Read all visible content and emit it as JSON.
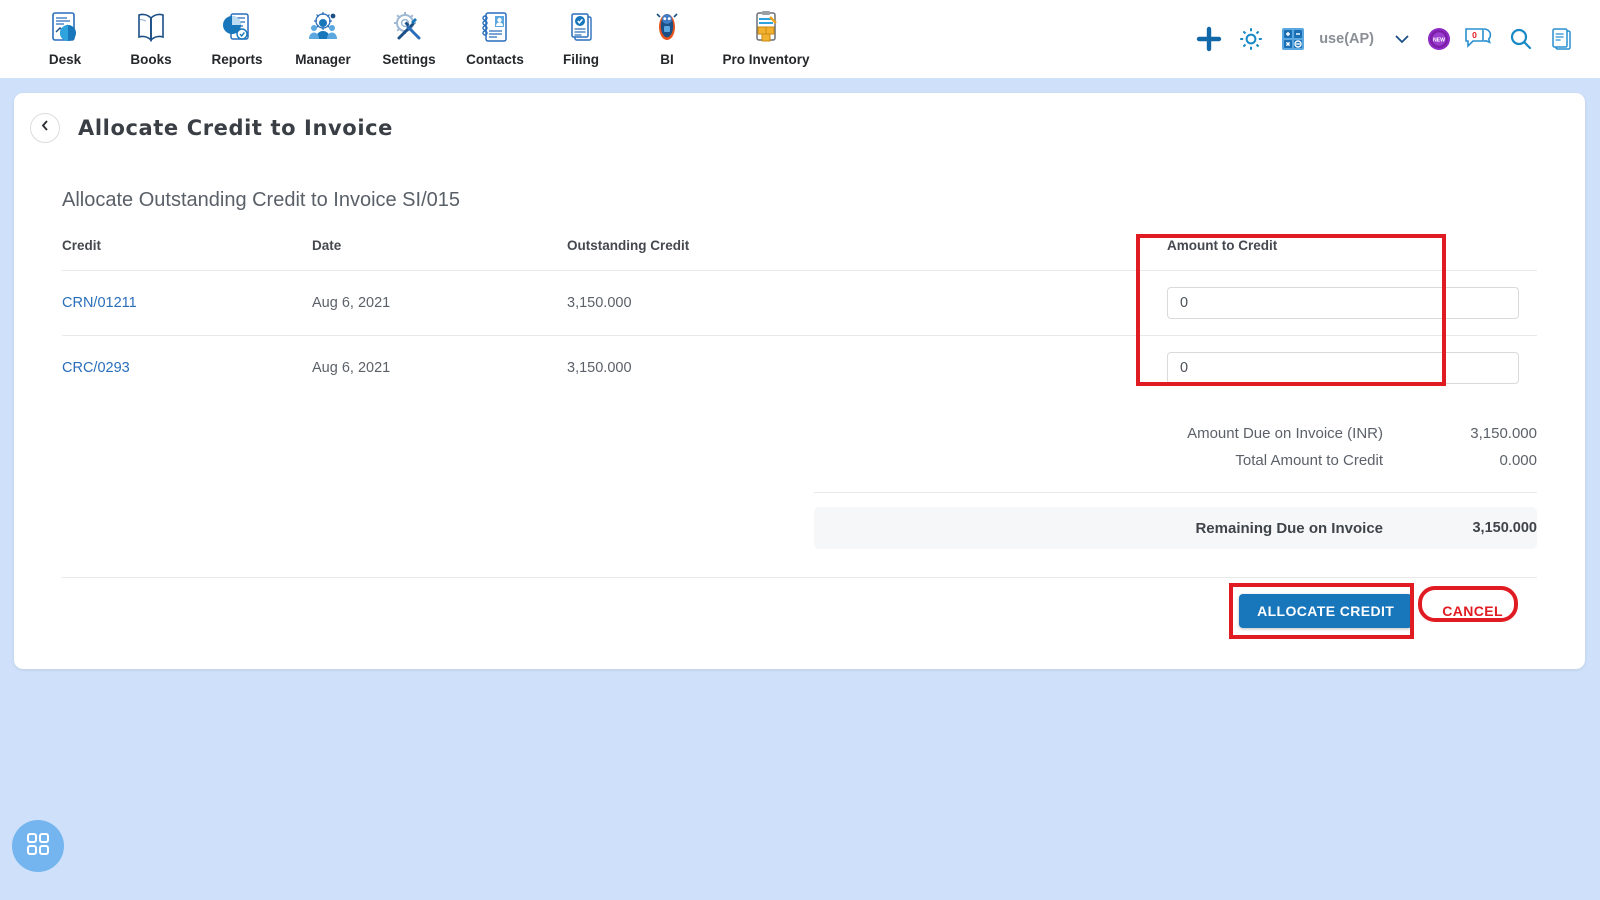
{
  "topbar": {
    "apps": [
      {
        "label": "Desk",
        "icon": "desk-icon"
      },
      {
        "label": "Books",
        "icon": "books-icon"
      },
      {
        "label": "Reports",
        "icon": "reports-icon"
      },
      {
        "label": "Manager",
        "icon": "manager-icon"
      },
      {
        "label": "Settings",
        "icon": "settings-icon"
      },
      {
        "label": "Contacts",
        "icon": "contacts-icon"
      },
      {
        "label": "Filing",
        "icon": "filing-icon"
      },
      {
        "label": "BI",
        "icon": "bi-icon"
      },
      {
        "label": "Pro Inventory",
        "icon": "pro-inventory-icon"
      }
    ],
    "org_name": "use(AP)",
    "new_badge_text": "NEW",
    "message_count": "0",
    "icons": {
      "add": "plus-icon",
      "settings": "gear-icon",
      "calculator": "calculator-icon",
      "dropdown": "chevron-down-icon",
      "new_badge": "new-badge-icon",
      "messages": "chat-bubble-icon",
      "search": "search-icon",
      "notes": "document-icon"
    }
  },
  "page": {
    "back_icon": "chevron-left-icon",
    "title": "Allocate Credit to Invoice",
    "subtitle": "Allocate Outstanding Credit to Invoice SI/015"
  },
  "table": {
    "headers": {
      "credit": "Credit",
      "date": "Date",
      "outstanding": "Outstanding Credit",
      "amount": "Amount to Credit"
    },
    "rows": [
      {
        "credit": "CRN/01211",
        "date": "Aug 6, 2021",
        "outstanding": "3,150.000",
        "amount": "0"
      },
      {
        "credit": "CRC/0293",
        "date": "Aug 6, 2021",
        "outstanding": "3,150.000",
        "amount": "0"
      }
    ]
  },
  "totals": {
    "amount_due_label": "Amount Due on Invoice (INR)",
    "amount_due_value": "3,150.000",
    "total_credit_label": "Total Amount to Credit",
    "total_credit_value": "0.000",
    "remaining_label": "Remaining Due on Invoice",
    "remaining_value": "3,150.000"
  },
  "actions": {
    "allocate_label": "ALLOCATE CREDIT",
    "cancel_label": "CANCEL"
  },
  "fab": {
    "icon": "grid-apps-icon"
  },
  "colors": {
    "page_background": "#cfe1fa",
    "primary_button": "#1876bb",
    "link": "#2a6ebb",
    "annotation_red": "#e01b22",
    "cancel_text": "#e01b22",
    "fab_background": "#74b5f0"
  }
}
